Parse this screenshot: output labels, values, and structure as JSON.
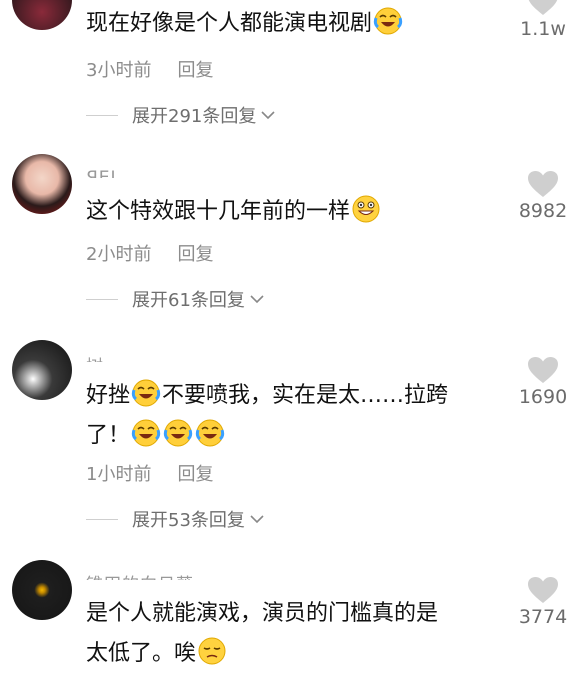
{
  "comments": [
    {
      "username": "",
      "text_parts": [
        "现在好像是个人都能演电视剧"
      ],
      "emoji_after": [
        "laugh-cry"
      ],
      "time": "3小时前",
      "reply_label": "回复",
      "expand_label": "展开291条回复",
      "likes": "1.1w"
    },
    {
      "username": "ЯEJ",
      "text_parts": [
        "这个特效跟十几年前的一样"
      ],
      "emoji_after": [
        "grin"
      ],
      "time": "2小时前",
      "reply_label": "回复",
      "expand_label": "展开61条回复",
      "likes": "8982"
    },
    {
      "username": "树",
      "text_line1_a": "好挫",
      "text_line1_b": "不要喷我，实在是太……拉跨",
      "text_line2": "了！",
      "time": "1小时前",
      "reply_label": "回复",
      "expand_label": "展开53条回复",
      "likes": "1690"
    },
    {
      "username": "锥田的向日葵",
      "text_line1": "是个人就能演戏，演员的门槛真的是",
      "text_line2": "太低了。唉",
      "likes": "3774"
    }
  ],
  "colors": {
    "heart": "#cfcfcf",
    "meta": "#8c8c8c",
    "text": "#111111"
  }
}
